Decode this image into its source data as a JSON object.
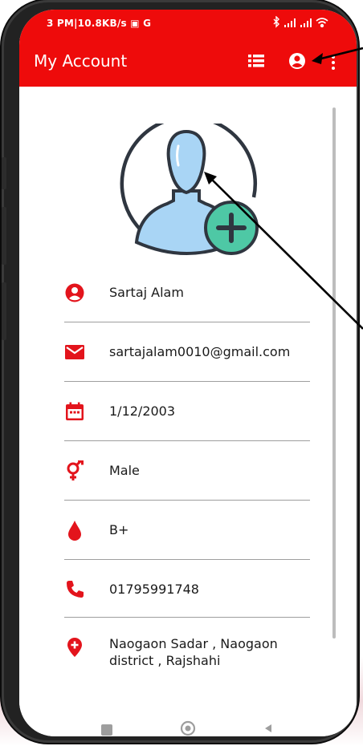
{
  "status_bar": {
    "left_text": "3 PM|10.8KB/s ▣ G",
    "right_icons": [
      "bluetooth-icon",
      "signal-icon",
      "signal-icon",
      "wifi-icon"
    ]
  },
  "app_bar": {
    "title": "My Account",
    "actions": [
      "list-icon",
      "account-circle-icon",
      "more-vert-icon"
    ],
    "color": "#ee0b0b"
  },
  "profile": {
    "avatar_icon": "person-avatar-icon",
    "add_photo_icon": "add-circle-icon",
    "accent": "#4ec8a5"
  },
  "fields": [
    {
      "icon": "person-icon",
      "value": "Sartaj Alam"
    },
    {
      "icon": "email-icon",
      "value": "sartajalam0010@gmail.com"
    },
    {
      "icon": "calendar-icon",
      "value": "1/12/2003"
    },
    {
      "icon": "gender-icon",
      "value": "Male"
    },
    {
      "icon": "blood-drop-icon",
      "value": "B+"
    },
    {
      "icon": "phone-icon",
      "value": "01795991748"
    },
    {
      "icon": "location-icon",
      "value": "Naogaon Sadar , Naogaon district , Rajshahi"
    }
  ],
  "nav_bar": [
    "recents-icon",
    "home-icon",
    "back-icon"
  ],
  "icon_color": "#e3141c"
}
